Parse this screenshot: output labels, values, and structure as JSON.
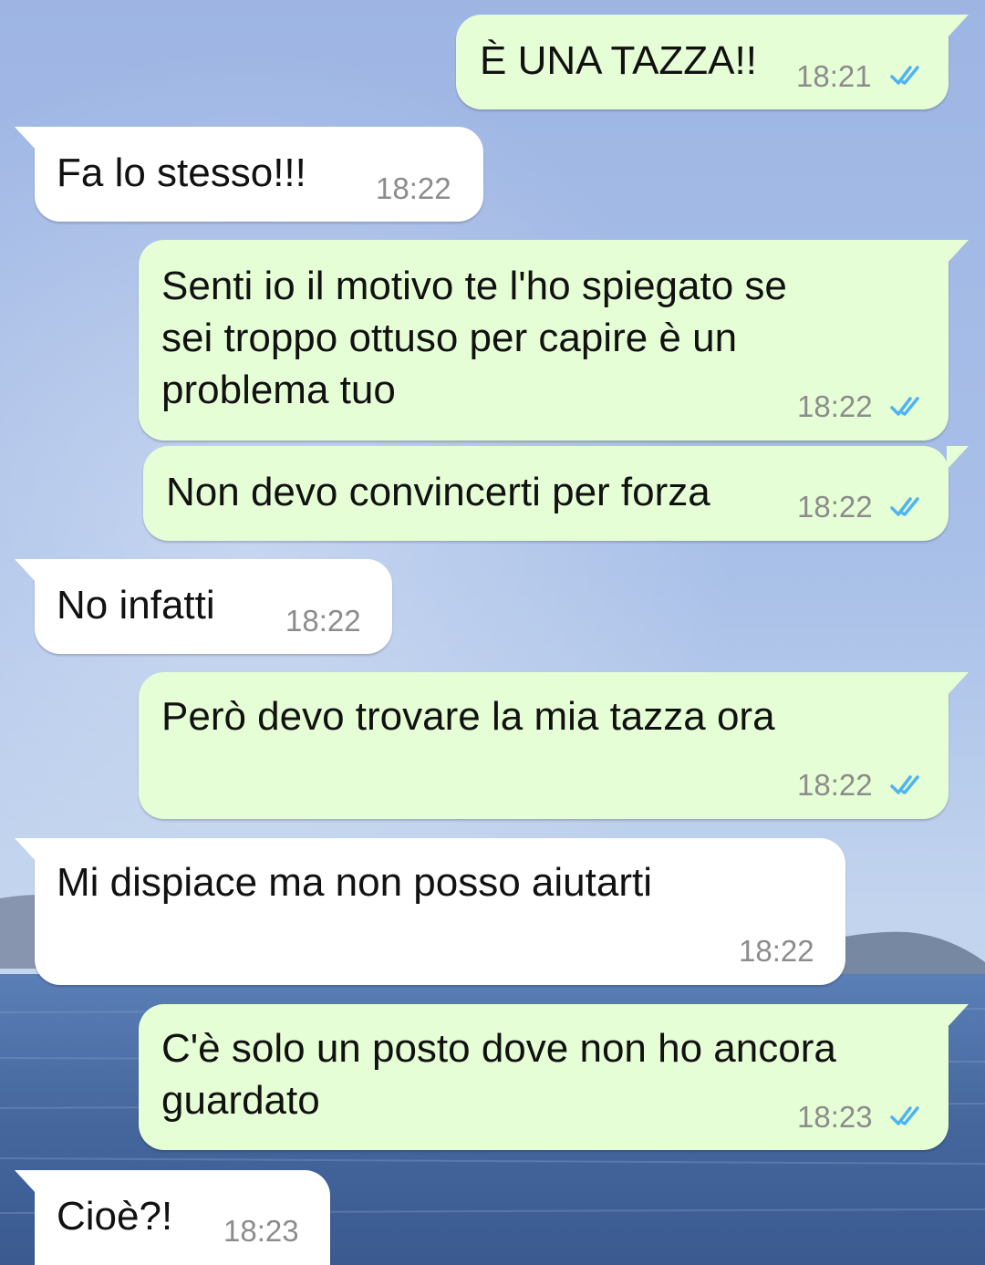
{
  "colors": {
    "outgoing_bubble": "#e6fed5",
    "incoming_bubble": "#ffffff",
    "text": "#111111",
    "timestamp": "#8c8c8c",
    "read_ticks": "#4fb3f2"
  },
  "messages": [
    {
      "direction": "out",
      "text": "È UNA TAZZA!!",
      "time": "18:21",
      "status": "read",
      "status_icon": "double-check-icon"
    },
    {
      "direction": "in",
      "text": "Fa lo stesso!!!",
      "time": "18:22"
    },
    {
      "direction": "out",
      "text": "Senti io il motivo te l'ho spiegato se\nsei troppo ottuso per capire è un\nproblema tuo",
      "time": "18:22",
      "status": "read",
      "status_icon": "double-check-icon"
    },
    {
      "direction": "out",
      "text": "Non devo convincerti per forza",
      "time": "18:22",
      "status": "read",
      "status_icon": "double-check-icon"
    },
    {
      "direction": "in",
      "text": "No infatti",
      "time": "18:22"
    },
    {
      "direction": "out",
      "text": "Però devo trovare la mia tazza ora",
      "time": "18:22",
      "status": "read",
      "status_icon": "double-check-icon"
    },
    {
      "direction": "in",
      "text": "Mi dispiace ma non posso aiutarti",
      "time": "18:22"
    },
    {
      "direction": "out",
      "text": "C'è solo un posto dove non ho ancora\nguardato",
      "time": "18:23",
      "status": "read",
      "status_icon": "double-check-icon"
    },
    {
      "direction": "in",
      "text": "Cioè?!",
      "time": "18:23"
    }
  ]
}
